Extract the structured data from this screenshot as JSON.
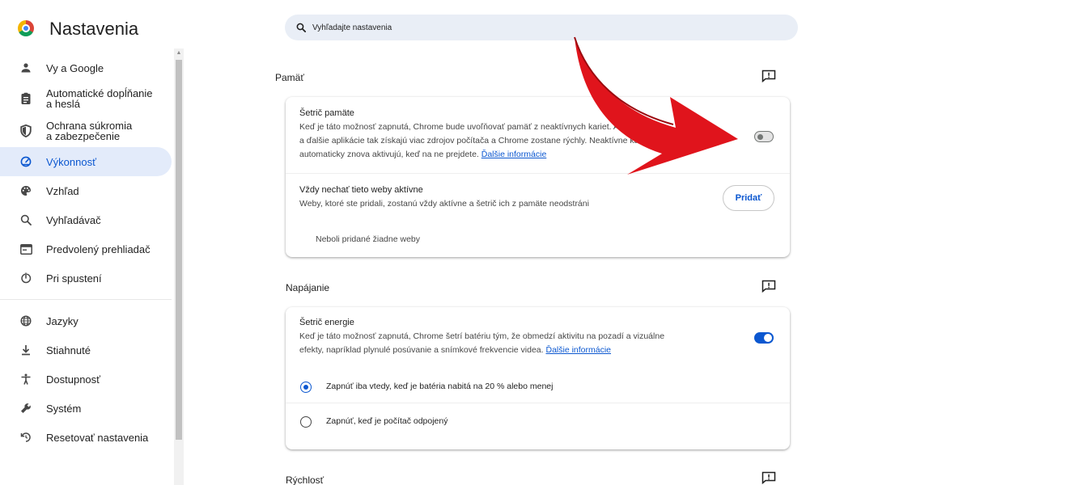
{
  "app": {
    "title": "Nastavenia"
  },
  "search": {
    "placeholder": "Vyhľadajte nastavenia"
  },
  "sidebar": {
    "items": [
      {
        "label": "Vy a Google",
        "icon": "person-icon"
      },
      {
        "label": "Automatické dopĺňanie\na heslá",
        "icon": "clipboard-icon"
      },
      {
        "label": "Ochrana súkromia\na zabezpečenie",
        "icon": "shield-icon"
      },
      {
        "label": "Výkonnosť",
        "icon": "speedometer-icon",
        "active": true
      },
      {
        "label": "Vzhľad",
        "icon": "palette-icon"
      },
      {
        "label": "Vyhľadávač",
        "icon": "search-icon"
      },
      {
        "label": "Predvolený prehliadač",
        "icon": "browser-icon"
      },
      {
        "label": "Pri spustení",
        "icon": "power-icon"
      },
      {
        "label": "Jazyky",
        "icon": "globe-icon"
      },
      {
        "label": "Stiahnuté",
        "icon": "download-icon"
      },
      {
        "label": "Dostupnosť",
        "icon": "accessibility-icon"
      },
      {
        "label": "Systém",
        "icon": "wrench-icon"
      },
      {
        "label": "Resetovať nastavenia",
        "icon": "reset-icon"
      }
    ]
  },
  "sections": {
    "memory": {
      "title": "Pamäť",
      "saver": {
        "title": "Šetrič pamäte",
        "desc1": "Keď je táto možnosť zapnutá, Chrome bude uvoľňovať pamäť z neaktívnych kariet. Aktí",
        "desc2": "a ďalšie aplikácie tak získajú viac zdrojov počítača a Chrome zostane rýchly. Neaktívne karty",
        "desc3": "automaticky znova aktivujú, keď na ne prejdete.",
        "link": "Ďalšie informácie",
        "enabled": false
      },
      "always_active": {
        "title": "Vždy nechať tieto weby aktívne",
        "desc": "Weby, ktoré ste pridali, zostanú vždy aktívne a šetrič ich z pamäte neodstráni",
        "button": "Pridať",
        "empty": "Neboli pridané žiadne weby"
      }
    },
    "power": {
      "title": "Napájanie",
      "saver": {
        "title": "Šetrič energie",
        "desc1": "Keď je táto možnosť zapnutá, Chrome šetrí batériu tým, že obmedzí aktivitu na pozadí a vizuálne",
        "desc2": "efekty, napríklad plynulé posúvanie a snímkové frekvencie videa.",
        "link": "Ďalšie informácie",
        "enabled": true
      },
      "options": [
        {
          "label": "Zapnúť iba vtedy, keď je batéria nabitá na 20 % alebo menej",
          "checked": true
        },
        {
          "label": "Zapnúť, keď je počítač odpojený",
          "checked": false
        }
      ]
    },
    "speed": {
      "title": "Rýchlosť"
    }
  },
  "colors": {
    "accent": "#0b57d0",
    "active_bg": "#e3ebfa",
    "arrow": "#e0141c"
  }
}
